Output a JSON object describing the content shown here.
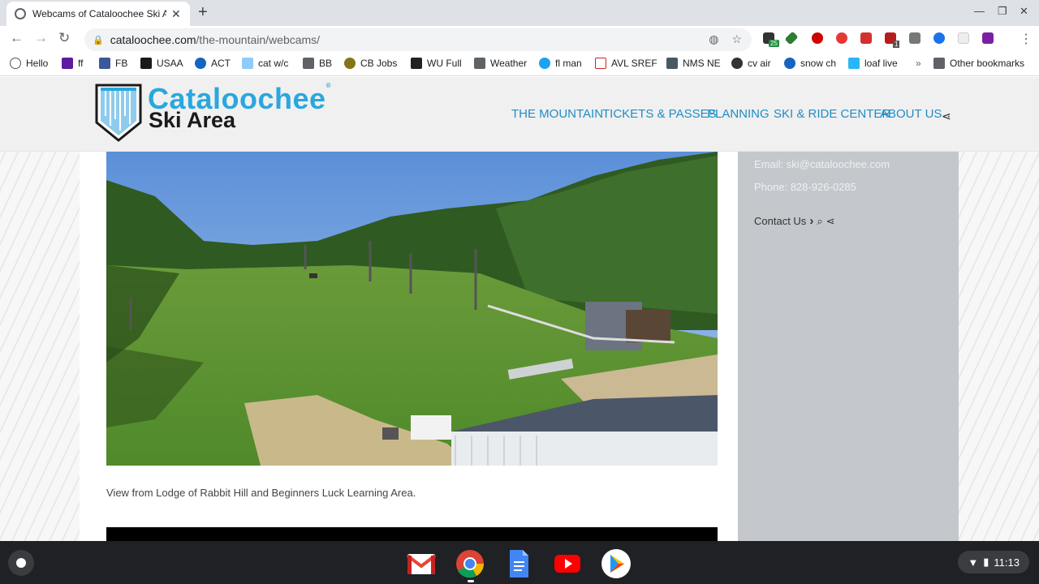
{
  "browser": {
    "tab_title": "Webcams of Cataloochee Ski Ar",
    "url_host": "cataloochee.com",
    "url_path": "/the-mountain/webcams/",
    "bookmarks": [
      "Hello",
      "ff",
      "FB",
      "USAA",
      "ACT",
      "cat w/c",
      "BB",
      "CB Jobs",
      "WU Full",
      "Weather",
      "fl man",
      "AVL SREF",
      "NMS NE",
      "cv air",
      "snow ch",
      "loaf live",
      "Other bookmarks"
    ],
    "ext_badge_1": "25",
    "ext_badge_2": "1"
  },
  "site": {
    "logo_line1": "Cataloochee",
    "logo_line2": "Ski Area",
    "logo_reg": "®",
    "menu": [
      "THE MOUNTAIN",
      "TICKETS & PASSES",
      "PLANNING",
      "SKI & RIDE CENTER",
      "ABOUT US"
    ],
    "caption": "View from Lodge of Rabbit Hill and Beginners Luck Learning Area.",
    "email": "Email:  ski@cataloochee.com",
    "phone": "Phone:  828-926-0285",
    "contact": "Contact Us"
  },
  "shelf": {
    "time": "11:13"
  },
  "colors": {
    "brand_blue": "#2aa7de",
    "menu_blue": "#1f8dc6",
    "sidebar_gray": "#c4c7cc"
  }
}
